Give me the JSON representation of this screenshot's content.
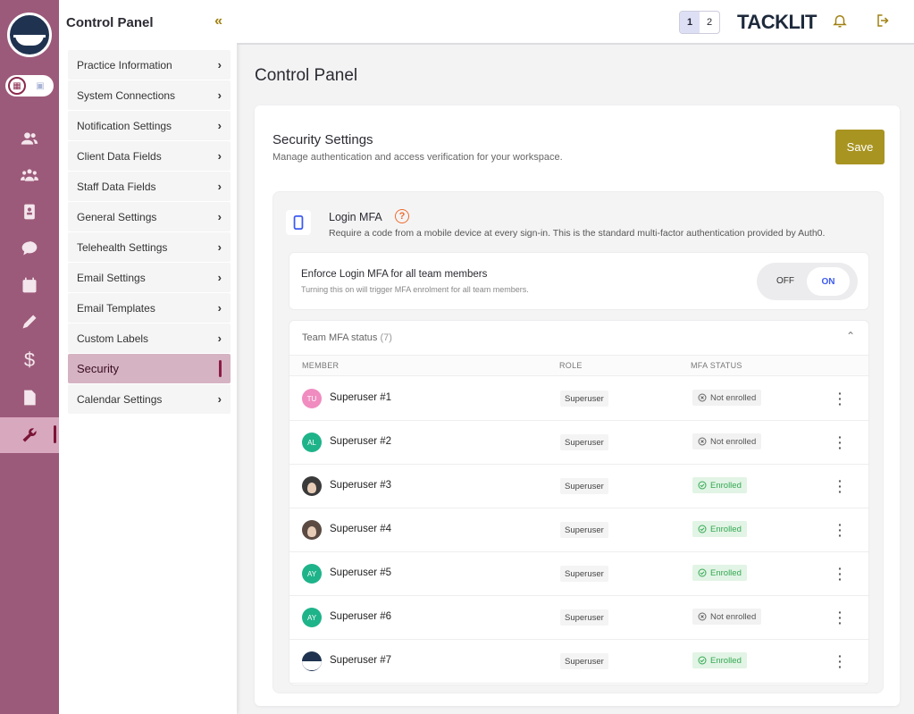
{
  "nav": {
    "title": "Control Panel",
    "items": [
      {
        "label": "Practice Information",
        "active": false
      },
      {
        "label": "System Connections",
        "active": false
      },
      {
        "label": "Notification Settings",
        "active": false
      },
      {
        "label": "Client Data Fields",
        "active": false
      },
      {
        "label": "Staff Data Fields",
        "active": false
      },
      {
        "label": "General Settings",
        "active": false
      },
      {
        "label": "Telehealth Settings",
        "active": false
      },
      {
        "label": "Email Settings",
        "active": false
      },
      {
        "label": "Email Templates",
        "active": false
      },
      {
        "label": "Custom Labels",
        "active": false
      },
      {
        "label": "Security",
        "active": true
      },
      {
        "label": "Calendar Settings",
        "active": false
      }
    ]
  },
  "header": {
    "pages": [
      "1",
      "2"
    ],
    "current_page": "1",
    "brand": "TACKLIT"
  },
  "page_title": "Control Panel",
  "security": {
    "title": "Security Settings",
    "subtitle": "Manage authentication and access verification for your workspace.",
    "save_label": "Save",
    "mfa": {
      "title": "Login MFA",
      "description": "Require a code from a mobile device at every sign-in. This is the standard multi-factor authentication provided by Auth0."
    },
    "enforce": {
      "title": "Enforce Login MFA for all team members",
      "subtitle": "Turning this on will trigger MFA enrolment for all team members.",
      "off_label": "OFF",
      "on_label": "ON",
      "value": "ON"
    },
    "team": {
      "title": "Team MFA status",
      "count": "(7)",
      "columns": [
        "MEMBER",
        "ROLE",
        "MFA STATUS"
      ],
      "rows": [
        {
          "initials": "TU",
          "avatar_color": "#f08cc0",
          "name": "Superuser #1",
          "role": "Superuser",
          "status": "Not enrolled",
          "enrolled": false
        },
        {
          "initials": "AL",
          "avatar_color": "#1fb38a",
          "name": "Superuser #2",
          "role": "Superuser",
          "status": "Not enrolled",
          "enrolled": false
        },
        {
          "initials": "",
          "avatar_color": "#3a3a3a",
          "name": "Superuser #3",
          "role": "Superuser",
          "status": "Enrolled",
          "enrolled": true
        },
        {
          "initials": "",
          "avatar_color": "#5a4a42",
          "name": "Superuser #4",
          "role": "Superuser",
          "status": "Enrolled",
          "enrolled": true
        },
        {
          "initials": "AY",
          "avatar_color": "#1fb38a",
          "name": "Superuser #5",
          "role": "Superuser",
          "status": "Enrolled",
          "enrolled": true
        },
        {
          "initials": "AY",
          "avatar_color": "#1fb38a",
          "name": "Superuser #6",
          "role": "Superuser",
          "status": "Not enrolled",
          "enrolled": false
        },
        {
          "initials": "",
          "avatar_color": "#1f3350",
          "name": "Superuser #7",
          "role": "Superuser",
          "status": "Enrolled",
          "enrolled": true
        }
      ]
    }
  },
  "colors": {
    "rail": "#9c5a7a",
    "accent_gold": "#a89421",
    "active_nav": "#d5b3c3",
    "toggle_on": "#3d5af1",
    "enrolled_green": "#34a853"
  },
  "icons": {
    "rail": [
      "users-icon",
      "group-icon",
      "contact-book-icon",
      "chat-icon",
      "calendar-icon",
      "pencil-icon",
      "dollar-icon",
      "document-icon",
      "wrench-icon"
    ]
  }
}
